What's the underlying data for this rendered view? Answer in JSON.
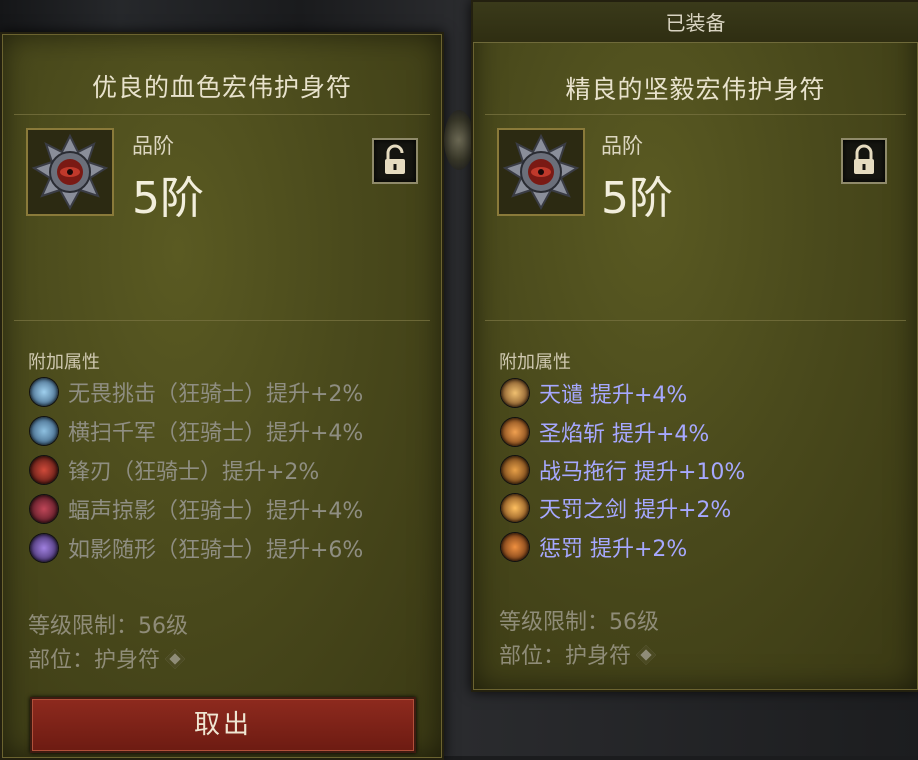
{
  "left_panel": {
    "title": "优良的血色宏伟护身符",
    "rank_label": "品阶",
    "rank_value": "5阶",
    "lock_state": "unlocked",
    "section_label": "附加属性",
    "affixes": [
      {
        "text": "无畏挑击（狂骑士）提升+2%",
        "icon_color": "#5fa0c8"
      },
      {
        "text": "横扫千军（狂骑士）提升+4%",
        "icon_color": "#4f8fb8"
      },
      {
        "text": "锋刃（狂骑士）提升+2%",
        "icon_color": "#b0342a"
      },
      {
        "text": "蝠声掠影（狂骑士）提升+4%",
        "icon_color": "#a03040"
      },
      {
        "text": "如影随形（狂骑士）提升+6%",
        "icon_color": "#7c5ab8"
      }
    ],
    "level_req": "等级限制：56级",
    "slot": "部位：护身符",
    "button_label": "取出"
  },
  "right_panel": {
    "header": "已装备",
    "title": "精良的坚毅宏伟护身符",
    "rank_label": "品阶",
    "rank_value": "5阶",
    "lock_state": "locked",
    "section_label": "附加属性",
    "affixes": [
      {
        "text": "天谴  提升+4%",
        "icon_color": "#c88a3a"
      },
      {
        "text": "圣焰斩  提升+4%",
        "icon_color": "#d0702a"
      },
      {
        "text": "战马拖行  提升+10%",
        "icon_color": "#c87a2a"
      },
      {
        "text": "天罚之剑  提升+2%",
        "icon_color": "#d88a2a"
      },
      {
        "text": "惩罚  提升+2%",
        "icon_color": "#c0682a"
      }
    ],
    "level_req": "等级限制：56级",
    "slot": "部位：护身符"
  },
  "colors": {
    "panel": "#4a4a1c",
    "affix_dim": "#8f8e82",
    "affix_bright": "#a6a8ff",
    "button": "#8e2a1e"
  }
}
